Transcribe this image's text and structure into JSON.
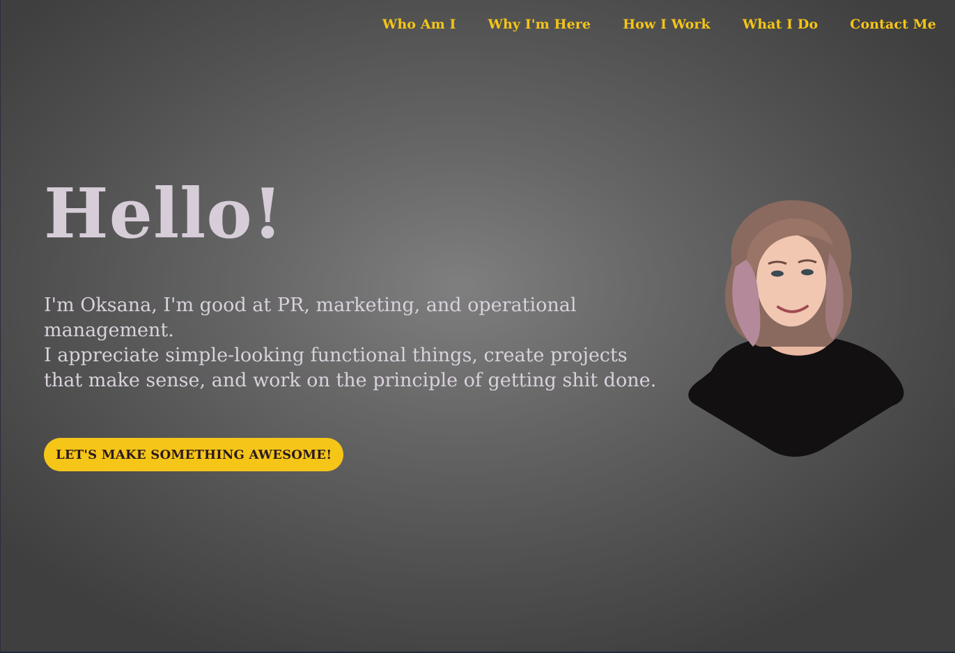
{
  "nav": {
    "items": [
      {
        "label": "Who Am I"
      },
      {
        "label": "Why I'm Here"
      },
      {
        "label": "How I Work"
      },
      {
        "label": "What I Do"
      },
      {
        "label": "Contact Me"
      }
    ]
  },
  "hero": {
    "title": "Hello!",
    "line1": "I'm Oksana, I'm good at PR, marketing, and operational management.",
    "line2": "I appreciate simple-looking functional things, create projects that make sense, and work on the principle of getting shit done.",
    "cta_label": "LET'S MAKE SOMETHING AWESOME!"
  },
  "colors": {
    "accent": "#f5c518",
    "heading": "#d6cdd9",
    "body_text": "#d9d2dc"
  }
}
